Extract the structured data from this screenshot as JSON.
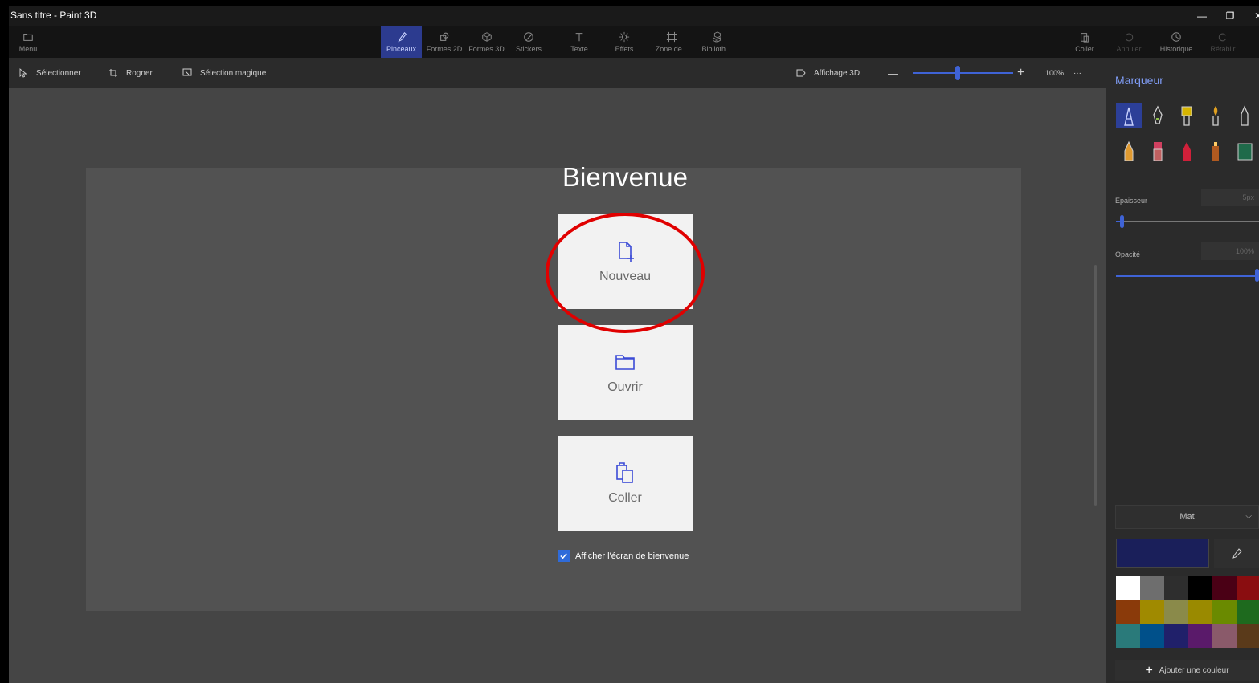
{
  "window": {
    "title": "Sans titre - Paint 3D"
  },
  "ribbon": {
    "menu": "Menu",
    "tools": [
      {
        "label": "Pinceaux",
        "icon": "brush-icon",
        "active": true
      },
      {
        "label": "Formes 2D",
        "icon": "shapes-2d-icon"
      },
      {
        "label": "Formes 3D",
        "icon": "cube-icon"
      },
      {
        "label": "Stickers",
        "icon": "sticker-icon"
      },
      {
        "label": "Texte",
        "icon": "text-icon"
      },
      {
        "label": "Effets",
        "icon": "sun-icon"
      },
      {
        "label": "Zone de...",
        "icon": "canvas-icon"
      },
      {
        "label": "Biblioth...",
        "icon": "library-icon"
      }
    ],
    "right": [
      {
        "label": "Coller",
        "icon": "paste-icon"
      },
      {
        "label": "Annuler",
        "icon": "undo-icon"
      },
      {
        "label": "Historique",
        "icon": "history-icon"
      },
      {
        "label": "Rétablir",
        "icon": "redo-icon"
      }
    ]
  },
  "toolbar": {
    "select": "Sélectionner",
    "crop": "Rogner",
    "magic_select": "Sélection magique",
    "view3d": "Affichage 3D",
    "zoom_minus": "—",
    "zoom_plus": "+",
    "zoom": "100%",
    "more": "···"
  },
  "welcome": {
    "title": "Bienvenue",
    "new": "Nouveau",
    "open": "Ouvrir",
    "paste": "Coller",
    "show_welcome": "Afficher l'écran de bienvenue"
  },
  "panel": {
    "title": "Marqueur",
    "thickness_label": "Épaisseur",
    "thickness_value": "5px",
    "opacity_label": "Opacité",
    "opacity_value": "100%",
    "finish": "Mat",
    "add_color": "Ajouter une couleur",
    "palette": [
      "#ffffff",
      "#6e6e6e",
      "#2e2e2e",
      "#000000",
      "#4a0015",
      "#8a0d10",
      "#8a3a0a",
      "#a08a00",
      "#8a8a4a",
      "#9a8a00",
      "#6a8a00",
      "#1e6a1e",
      "#2a7a7a",
      "#00508a",
      "#20206a",
      "#5a1a6a",
      "#8a5a6a",
      "#5a3a1a"
    ]
  }
}
